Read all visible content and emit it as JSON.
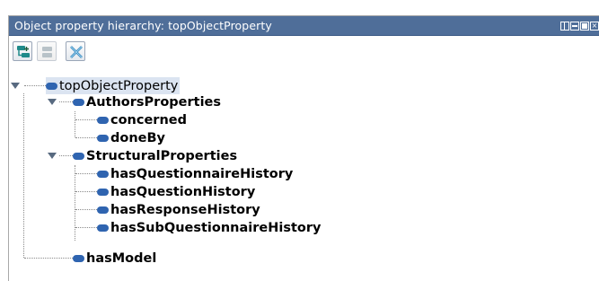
{
  "panel": {
    "title": "Object property hierarchy: topObjectProperty"
  },
  "toolbar": {
    "buttons": [
      {
        "name": "add-subproperty-button",
        "icon": "add-subproperty-icon",
        "enabled": true
      },
      {
        "name": "add-sibling-property-button",
        "icon": "add-sibling-property-icon",
        "enabled": false
      },
      {
        "name": "delete-property-button",
        "icon": "delete-property-icon",
        "enabled": true
      }
    ]
  },
  "tree": {
    "root": "topObjectProperty",
    "authors": "AuthorsProperties",
    "concerned": "concerned",
    "doneBy": "doneBy",
    "structural": "StructuralProperties",
    "hasQuestionnaireHistory": "hasQuestionnaireHistory",
    "hasQuestionHistory": "hasQuestionHistory",
    "hasResponseHistory": "hasResponseHistory",
    "hasSubQuestionnaireHistory": "hasSubQuestionnaireHistory",
    "hasModel": "hasModel"
  },
  "colors": {
    "titlebar": "#4f6e99",
    "property_icon": "#2f64b0",
    "selection": "#dbe4f1"
  }
}
